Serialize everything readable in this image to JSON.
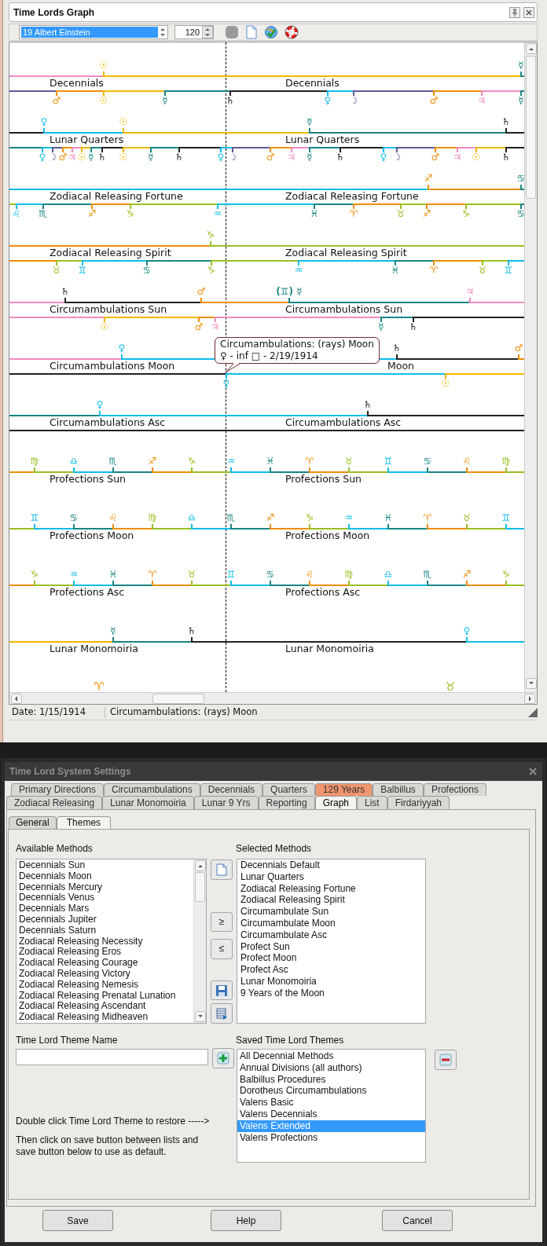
{
  "window": {
    "title": "Time Lords Graph"
  },
  "toolbar": {
    "chart_select": "19 Albert Einstein",
    "zoom": "120"
  },
  "graph": {
    "tracks": [
      {
        "labels": [
          "Decennials",
          "Decennials"
        ],
        "upper": {
          "segments": [
            {
              "color": "#f08cc0"
            },
            {
              "glyph": "☉",
              "color": "#f0b800"
            },
            {
              "glyph": "☿",
              "color": "#1a8585"
            }
          ]
        },
        "lower": {
          "segments": [
            {
              "color": "#5b5b9a"
            },
            {
              "glyph": "♂",
              "color": "#f0900a"
            },
            {
              "glyph": "☉",
              "color": "#f0b800"
            },
            {
              "glyph": "☿",
              "color": "#1a8585"
            },
            {
              "glyph": "♄",
              "color": "#222222"
            },
            {
              "glyph": "♀",
              "color": "#10bde8"
            },
            {
              "glyph": "☽",
              "color": "#5b5b9a"
            },
            {
              "glyph": "♂",
              "color": "#f0900a"
            },
            {
              "glyph": "♃",
              "color": "#f08cc0"
            },
            {
              "glyph": "☿",
              "color": "#1a8585"
            }
          ]
        }
      },
      {
        "labels": [
          "Lunar Quarters",
          "Lunar Quarters"
        ],
        "upper": {
          "segments": [
            {
              "color": "#222222"
            },
            {
              "glyph": "♀",
              "color": "#10bde8"
            },
            {
              "glyph": "☉",
              "color": "#f0b800"
            },
            {
              "glyph": "☿",
              "color": "#1a8585"
            },
            {
              "glyph": "♄",
              "color": "#222222"
            }
          ]
        },
        "lower": {
          "segments": [
            {
              "color": "#1a8585"
            },
            {
              "glyph": "♀",
              "color": "#10bde8"
            },
            {
              "glyph": "☽",
              "color": "#5b5b9a"
            },
            {
              "glyph": "♂",
              "color": "#f0900a"
            },
            {
              "glyph": "♃",
              "color": "#f08cc0"
            },
            {
              "glyph": "☉",
              "color": "#f0b800"
            },
            {
              "glyph": "☿",
              "color": "#1a8585"
            },
            {
              "glyph": "♄",
              "color": "#222222"
            },
            {
              "glyph": "☉",
              "color": "#f0b800"
            },
            {
              "glyph": "☿",
              "color": "#1a8585"
            },
            {
              "glyph": "♄",
              "color": "#222222"
            },
            {
              "glyph": "♀",
              "color": "#10bde8"
            },
            {
              "glyph": "☽",
              "color": "#5b5b9a"
            },
            {
              "glyph": "♂",
              "color": "#f0900a"
            },
            {
              "glyph": "♃",
              "color": "#f08cc0"
            },
            {
              "glyph": "☿",
              "color": "#1a8585"
            },
            {
              "glyph": "♄",
              "color": "#222222"
            },
            {
              "glyph": "♀",
              "color": "#10bde8"
            },
            {
              "glyph": "☽",
              "color": "#5b5b9a"
            },
            {
              "glyph": "♂",
              "color": "#f0900a"
            },
            {
              "glyph": "♃",
              "color": "#f08cc0"
            },
            {
              "glyph": "☉",
              "color": "#f0b800"
            },
            {
              "glyph": "♄",
              "color": "#222222"
            }
          ]
        }
      },
      {
        "labels": [
          "Zodiacal Releasing Fortune",
          "Zodiacal Releasing Fortune"
        ],
        "upper": {
          "segments": [
            {
              "color": "#10bde8"
            },
            {
              "glyph": "♐",
              "color": "#f0900a"
            },
            {
              "glyph": "♋",
              "color": "#1a8585"
            }
          ]
        },
        "lower": {
          "segments": [
            {
              "color": "#99c020"
            },
            {
              "glyph": "♌",
              "color": "#10bde8"
            },
            {
              "glyph": "♏",
              "color": "#1a8585"
            },
            {
              "glyph": "♐",
              "color": "#f0900a"
            },
            {
              "glyph": "♑",
              "color": "#99c020"
            },
            {
              "glyph": "♒",
              "color": "#10bde8"
            },
            {
              "glyph": "♓",
              "color": "#1a8585"
            },
            {
              "glyph": "♈",
              "color": "#f0900a"
            },
            {
              "glyph": "♉",
              "color": "#99c020"
            },
            {
              "glyph": "♐",
              "color": "#f0900a"
            },
            {
              "glyph": "♑",
              "color": "#99c020"
            },
            {
              "glyph": "♋",
              "color": "#1a8585"
            }
          ]
        }
      },
      {
        "labels": [
          "Zodiacal Releasing Spirit",
          "Zodiacal Releasing Spirit"
        ],
        "upper": {
          "segments": [
            {
              "color": "#f0900a"
            },
            {
              "glyph": "♑",
              "color": "#99c020"
            }
          ]
        },
        "lower": {
          "segments": [
            {
              "color": "#f0900a"
            },
            {
              "glyph": "♉",
              "color": "#99c020"
            },
            {
              "glyph": "♊",
              "color": "#10bde8"
            },
            {
              "glyph": "♋",
              "color": "#1a8585"
            },
            {
              "glyph": "♑",
              "color": "#99c020"
            },
            {
              "glyph": "♒",
              "color": "#10bde8"
            },
            {
              "glyph": "♓",
              "color": "#1a8585"
            },
            {
              "glyph": "♈",
              "color": "#f0900a"
            },
            {
              "glyph": "♉",
              "color": "#99c020"
            },
            {
              "glyph": "♊",
              "color": "#10bde8"
            }
          ]
        }
      },
      {
        "labels": [
          "Circumambulations Sun",
          "Circumambulations Sun"
        ],
        "upper": {
          "segments": [
            {
              "color": "#f08cc0"
            },
            {
              "glyph": "♄",
              "color": "#222222"
            },
            {
              "glyph": "♂",
              "color": "#f0900a"
            },
            {
              "glyph": "(♊) ☿",
              "color": "#1a8585"
            },
            {
              "glyph": "♃",
              "color": "#f08cc0"
            }
          ]
        },
        "lower": {
          "segments": [
            {
              "color": "#f08cc0"
            },
            {
              "glyph": "☉",
              "color": "#f0b800"
            },
            {
              "glyph": "♂",
              "color": "#f0900a"
            },
            {
              "glyph": "♃",
              "color": "#f08cc0"
            },
            {
              "glyph": "☿",
              "color": "#1a8585"
            },
            {
              "glyph": "♄",
              "color": "#222222"
            }
          ]
        }
      },
      {
        "labels": [
          "Circumambulations Moon",
          "Moon"
        ],
        "upper": {
          "segments": [
            {
              "color": "#f08cc0"
            },
            {
              "glyph": "♀",
              "color": "#10bde8"
            },
            {
              "glyph": "♄",
              "color": "#222222"
            },
            {
              "glyph": "♂",
              "color": "#f0900a"
            }
          ]
        },
        "lower": {
          "segments": [
            {
              "color": "#222222"
            },
            {
              "glyph": "♀",
              "color": "#10bde8"
            },
            {
              "glyph": "☉",
              "color": "#f0b800"
            }
          ]
        }
      },
      {
        "labels": [
          "Circumambulations Asc",
          "Circumambulations Asc"
        ],
        "upper": {
          "segments": [
            {
              "color": "#1a8585"
            },
            {
              "glyph": "♀",
              "color": "#10bde8"
            },
            {
              "glyph": "♄",
              "color": "#222222"
            }
          ]
        },
        "lower": {
          "segments": [
            {
              "color": "#222222"
            }
          ]
        }
      },
      {
        "labels": [
          "Profections Sun",
          "Profections Sun"
        ],
        "upper": {
          "segments": [
            {
              "color": "#f0900a"
            },
            {
              "glyph": "♍",
              "color": "#99c020"
            },
            {
              "glyph": "♎",
              "color": "#10bde8"
            },
            {
              "glyph": "♏",
              "color": "#1a8585"
            },
            {
              "glyph": "♐",
              "color": "#f0900a"
            },
            {
              "glyph": "♑",
              "color": "#99c020"
            },
            {
              "glyph": "♒",
              "color": "#10bde8"
            },
            {
              "glyph": "♓",
              "color": "#1a8585"
            },
            {
              "glyph": "♈",
              "color": "#f0900a"
            },
            {
              "glyph": "♉",
              "color": "#99c020"
            },
            {
              "glyph": "♊",
              "color": "#10bde8"
            },
            {
              "glyph": "♋",
              "color": "#1a8585"
            },
            {
              "glyph": "♌",
              "color": "#f0900a"
            },
            {
              "glyph": "♍",
              "color": "#99c020"
            }
          ]
        }
      },
      {
        "labels": [
          "Profections Moon",
          "Profections Moon"
        ],
        "upper": {
          "segments": [
            {
              "color": "#99c020"
            },
            {
              "glyph": "♊",
              "color": "#10bde8"
            },
            {
              "glyph": "♋",
              "color": "#1a8585"
            },
            {
              "glyph": "♌",
              "color": "#f0900a"
            },
            {
              "glyph": "♍",
              "color": "#99c020"
            },
            {
              "glyph": "♎",
              "color": "#10bde8"
            },
            {
              "glyph": "♏",
              "color": "#1a8585"
            },
            {
              "glyph": "♐",
              "color": "#f0900a"
            },
            {
              "glyph": "♑",
              "color": "#99c020"
            },
            {
              "glyph": "♒",
              "color": "#10bde8"
            },
            {
              "glyph": "♓",
              "color": "#1a8585"
            },
            {
              "glyph": "♈",
              "color": "#f0900a"
            },
            {
              "glyph": "♉",
              "color": "#99c020"
            },
            {
              "glyph": "♊",
              "color": "#10bde8"
            }
          ]
        }
      },
      {
        "labels": [
          "Profections Asc",
          "Profections Asc"
        ],
        "upper": {
          "segments": [
            {
              "color": "#f0900a"
            },
            {
              "glyph": "♑",
              "color": "#99c020"
            },
            {
              "glyph": "♒",
              "color": "#10bde8"
            },
            {
              "glyph": "♓",
              "color": "#1a8585"
            },
            {
              "glyph": "♈",
              "color": "#f0900a"
            },
            {
              "glyph": "♉",
              "color": "#99c020"
            },
            {
              "glyph": "♊",
              "color": "#10bde8"
            },
            {
              "glyph": "♋",
              "color": "#1a8585"
            },
            {
              "glyph": "♌",
              "color": "#f0900a"
            },
            {
              "glyph": "♍",
              "color": "#99c020"
            },
            {
              "glyph": "♎",
              "color": "#10bde8"
            },
            {
              "glyph": "♏",
              "color": "#1a8585"
            },
            {
              "glyph": "♐",
              "color": "#f0900a"
            },
            {
              "glyph": "♑",
              "color": "#99c020"
            }
          ]
        }
      },
      {
        "labels": [
          "Lunar Monomoiria",
          "Lunar Monomoiria"
        ],
        "upper": {
          "segments": [
            {
              "color": "#f0b800"
            },
            {
              "glyph": "☿",
              "color": "#1a8585"
            },
            {
              "glyph": "♄",
              "color": "#222222"
            },
            {
              "glyph": "♀",
              "color": "#10bde8"
            }
          ]
        }
      },
      {
        "upper": {
          "markers": [
            {
              "glyph": "♈",
              "color": "#f0900a"
            },
            {
              "glyph": "♉",
              "color": "#99c020"
            }
          ]
        }
      }
    ],
    "tooltip": {
      "title": "Circumambulations: (rays) Moon",
      "detail": "♀ - inf □ - 2/19/1914"
    }
  },
  "status_bar": [
    "Date: 1/15/1914",
    "Circumambulations: (rays) Moon"
  ],
  "dialog": {
    "title": "Time Lord System Settings",
    "tab_rows": [
      [
        {
          "label": "Primary Directions",
          "selected": false,
          "highlighted": false
        },
        {
          "label": "Circumambulations",
          "selected": false,
          "highlighted": false
        },
        {
          "label": "Decennials",
          "selected": false,
          "highlighted": false
        },
        {
          "label": "Quarters",
          "selected": false,
          "highlighted": false
        },
        {
          "label": "129 Years",
          "selected": false,
          "highlighted": true
        },
        {
          "label": "Balbillus",
          "selected": false,
          "highlighted": false
        },
        {
          "label": "Profections",
          "selected": false,
          "highlighted": false
        }
      ],
      [
        {
          "label": "Zodiacal Releasing",
          "selected": false,
          "highlighted": false
        },
        {
          "label": "Lunar Monomoiria",
          "selected": false,
          "highlighted": false
        },
        {
          "label": "Lunar 9 Yrs",
          "selected": false,
          "highlighted": false
        },
        {
          "label": "Reporting",
          "selected": false,
          "highlighted": false
        },
        {
          "label": "Graph",
          "selected": true,
          "highlighted": false
        },
        {
          "label": "List",
          "selected": false,
          "highlighted": false
        },
        {
          "label": "Firdariyyah",
          "selected": false,
          "highlighted": false
        }
      ]
    ],
    "subtabs": [
      {
        "label": "General",
        "selected": false
      },
      {
        "label": "Themes",
        "selected": true
      }
    ],
    "available_methods": {
      "label": "Available Methods",
      "items": [
        "Decennials Sun",
        "Decennials Moon",
        "Decennials Mercury",
        "Decennials Venus",
        "Decennials Mars",
        "Decennials Jupiter",
        "Decennials Saturn",
        "Zodiacal Releasing Necessity",
        "Zodiacal Releasing Eros",
        "Zodiacal Releasing Courage",
        "Zodiacal Releasing Victory",
        "Zodiacal Releasing Nemesis",
        "Zodiacal Releasing Prenatal Lunation",
        "Zodiacal Releasing Ascendant",
        "Zodiacal Releasing Midheaven"
      ]
    },
    "move_buttons": [
      "≥",
      "≤"
    ],
    "selected_methods": {
      "label": "Selected Methods",
      "items": [
        "Decennials Default",
        "Lunar Quarters",
        "Zodiacal Releasing Fortune",
        "Zodiacal Releasing Spirit",
        "Circumambulate Sun",
        "Circumambulate Moon",
        "Circumambulate Asc",
        "Profect Sun",
        "Profect Moon",
        "Profect Asc",
        "Lunar Monomoiria",
        "9 Years of the Moon"
      ]
    },
    "theme_name": {
      "label": "Time Lord Theme Name"
    },
    "saved_themes": {
      "label": "Saved Time Lord Themes",
      "items": [
        {
          "label": "All Decennial Methods",
          "selected": false
        },
        {
          "label": "Annual Divisions (all authors)",
          "selected": false
        },
        {
          "label": "Balbillus Procedures",
          "selected": false
        },
        {
          "label": "Dorotheus Circumambulations",
          "selected": false
        },
        {
          "label": "Valens Basic",
          "selected": false
        },
        {
          "label": "Valens Decennials",
          "selected": false
        },
        {
          "label": "Valens Extended",
          "selected": true
        },
        {
          "label": "Valens Profections",
          "selected": false
        }
      ]
    },
    "hints": [
      "Double click Time Lord Theme to restore ----->",
      "Then click on save button between lists and save button below to use as default."
    ],
    "buttons": [
      "Save",
      "Help",
      "Cancel"
    ]
  }
}
